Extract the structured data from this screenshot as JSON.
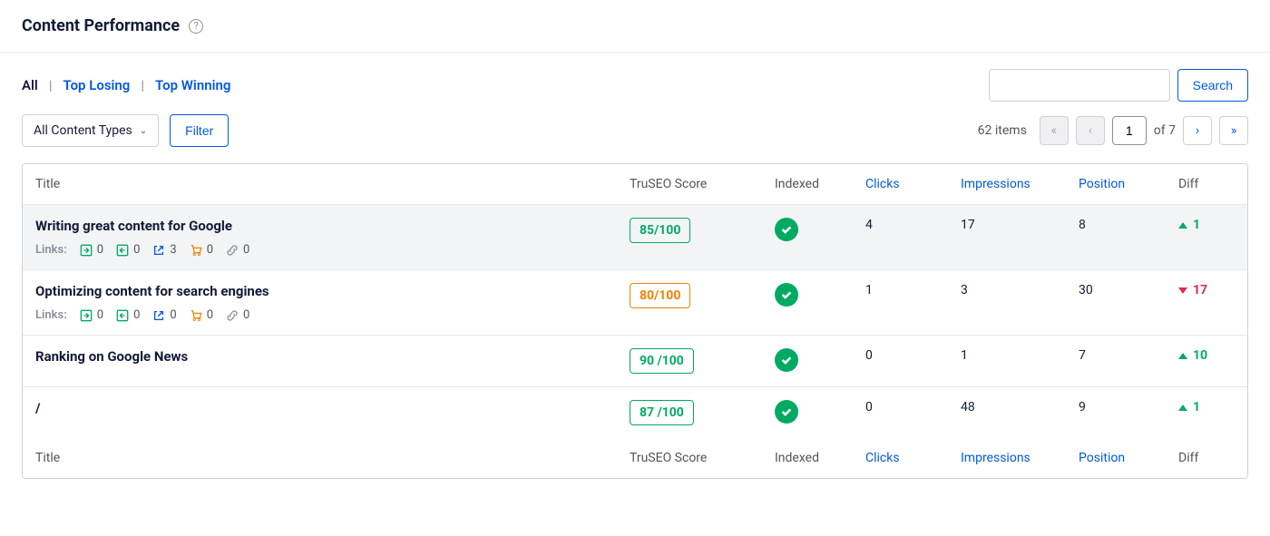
{
  "header": {
    "title": "Content Performance"
  },
  "tabs": {
    "all": "All",
    "losing": "Top Losing",
    "winning": "Top Winning"
  },
  "search": {
    "button": "Search"
  },
  "filters": {
    "dropdown": "All Content Types",
    "filter": "Filter"
  },
  "pagination": {
    "count": "62 items",
    "page": "1",
    "of": "of 7"
  },
  "columns": {
    "title": "Title",
    "score": "TruSEO Score",
    "indexed": "Indexed",
    "clicks": "Clicks",
    "impressions": "Impressions",
    "position": "Position",
    "diff": "Diff"
  },
  "links_label": "Links:",
  "rows": [
    {
      "title": "Writing great content for Google",
      "links": {
        "in": "0",
        "out": "0",
        "ext": "3",
        "aff": "0",
        "url": "0"
      },
      "score": "85/100",
      "score_color": "green",
      "clicks": "4",
      "impressions": "17",
      "position": "8",
      "diff": "1",
      "diff_dir": "up",
      "hover": true,
      "show_links": true
    },
    {
      "title": "Optimizing content for search engines",
      "links": {
        "in": "0",
        "out": "0",
        "ext": "0",
        "aff": "0",
        "url": "0"
      },
      "score": "80/100",
      "score_color": "orange",
      "clicks": "1",
      "impressions": "3",
      "position": "30",
      "diff": "17",
      "diff_dir": "down",
      "show_links": true
    },
    {
      "title": "Ranking on Google News",
      "score": "90 /100",
      "score_color": "green",
      "clicks": "0",
      "impressions": "1",
      "position": "7",
      "diff": "10",
      "diff_dir": "up",
      "show_links": false
    },
    {
      "title": "/",
      "score": "87 /100",
      "score_color": "green",
      "clicks": "0",
      "impressions": "48",
      "position": "9",
      "diff": "1",
      "diff_dir": "up",
      "show_links": false
    }
  ]
}
